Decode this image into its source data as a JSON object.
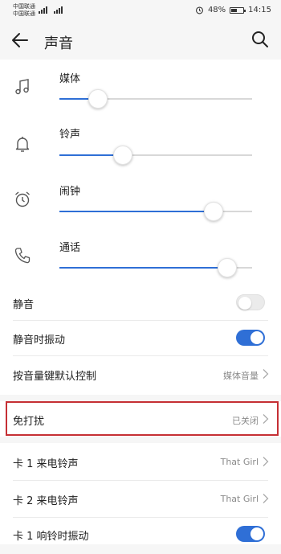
{
  "status_bar": {
    "carrier_1": "中国联通",
    "carrier_2": "中国联通",
    "signal_label": "4G",
    "battery_percent": "48%",
    "battery_level": 0.48,
    "time": "14:15",
    "alarm_icon": "alarm-icon"
  },
  "header": {
    "title": "声音",
    "back_icon": "arrow-left-icon",
    "search_icon": "search-icon"
  },
  "sliders": [
    {
      "label": "媒体",
      "icon": "music-note-icon",
      "level": 0.2
    },
    {
      "label": "铃声",
      "icon": "bell-icon",
      "level": 0.33
    },
    {
      "label": "闹钟",
      "icon": "alarm-clock-icon",
      "level": 0.8
    },
    {
      "label": "通话",
      "icon": "phone-icon",
      "level": 0.87
    }
  ],
  "switches": [
    {
      "label": "静音",
      "on": false
    },
    {
      "label": "静音时振动",
      "on": true
    }
  ],
  "volume_key": {
    "label": "按音量键默认控制",
    "value": "媒体音量"
  },
  "do_not_disturb": {
    "label": "免打扰",
    "value": "已关闭"
  },
  "ringtones": [
    {
      "label": "卡 1 来电铃声",
      "value": "That Girl"
    },
    {
      "label": "卡 2 来电铃声",
      "value": "That Girl"
    }
  ],
  "ring_vibrate": {
    "label": "卡 1 响铃时振动",
    "on": true
  },
  "colors": {
    "accent": "#2f6fd6",
    "highlight": "#c52f34",
    "secondary_text": "#8a8a8a",
    "background": "#f6f6f6"
  }
}
